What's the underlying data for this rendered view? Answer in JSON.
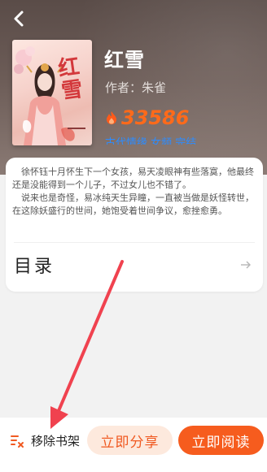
{
  "header": {
    "back_icon": "back-chevron-icon"
  },
  "book": {
    "cover_text": "红雪",
    "title": "红雪",
    "author": "作者：朱雀",
    "heat_icon": "flame-icon",
    "heat": "33586",
    "tags": "古代情缘 女频 完结"
  },
  "synopsis": {
    "paragraph1": "徐怀钰十月怀生下一个女孩，易天凌眼神有些落寞，他最终还是没能得到一个儿子，不过女儿也不错了。",
    "paragraph2": "说来也是奇怪，易冰纯天生异瞳，一直被当做是妖怪转世，在这除妖盛行的世间，她饱受着世间争议，愈挫愈勇。"
  },
  "toc": {
    "label": "目录",
    "arrow_icon": "arrow-right-icon"
  },
  "actions": {
    "remove_icon": "bookshelf-remove-icon",
    "remove_label": "移除书架",
    "share_label": "立即分享",
    "read_label": "立即阅读"
  },
  "colors": {
    "accent": "#f65c1e",
    "share_bg": "#fde9dd",
    "heat": "#ff6a1a",
    "tags": "#2d8cff",
    "annotation_arrow": "#f0424f"
  }
}
